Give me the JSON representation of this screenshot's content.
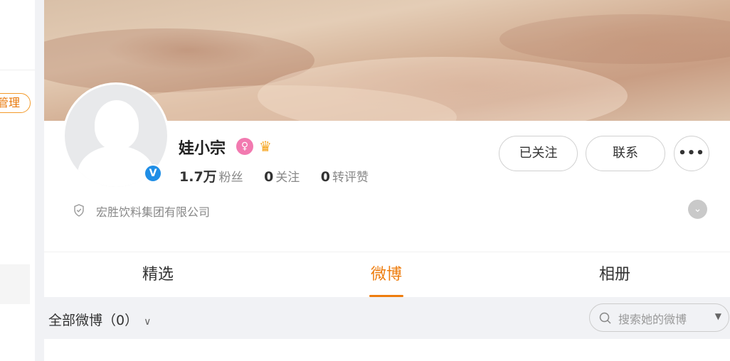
{
  "sidebar": {
    "manage_label": "管理"
  },
  "profile": {
    "name": "娃小宗",
    "verified_icon": "V",
    "badges": [
      {
        "name": "female-badge-icon",
        "glyph": "♀",
        "color": "#f27ab0"
      },
      {
        "name": "crown-badge-icon",
        "glyph": "♛",
        "color": "#f6a623"
      }
    ],
    "stats": {
      "followers_num": "1.7万",
      "followers_label": "粉丝",
      "following_num": "0",
      "following_label": "关注",
      "reposts_num": "0",
      "reposts_label": "转评赞"
    },
    "company": "宏胜饮料集团有限公司",
    "more_glyph": "•••",
    "expand_glyph": "⌄"
  },
  "actions": {
    "followed_label": "已关注",
    "contact_label": "联系"
  },
  "tabs": [
    {
      "label": "精选",
      "active": false
    },
    {
      "label": "微博",
      "active": true
    },
    {
      "label": "相册",
      "active": false
    }
  ],
  "filter": {
    "label": "全部微博（0）",
    "chevron": "∨"
  },
  "search": {
    "placeholder": "搜索她的微博",
    "caret": "▼"
  },
  "colors": {
    "accent": "#ee7d0e",
    "verified_blue": "#1f8ee6",
    "manage_border": "#f39a2a"
  }
}
